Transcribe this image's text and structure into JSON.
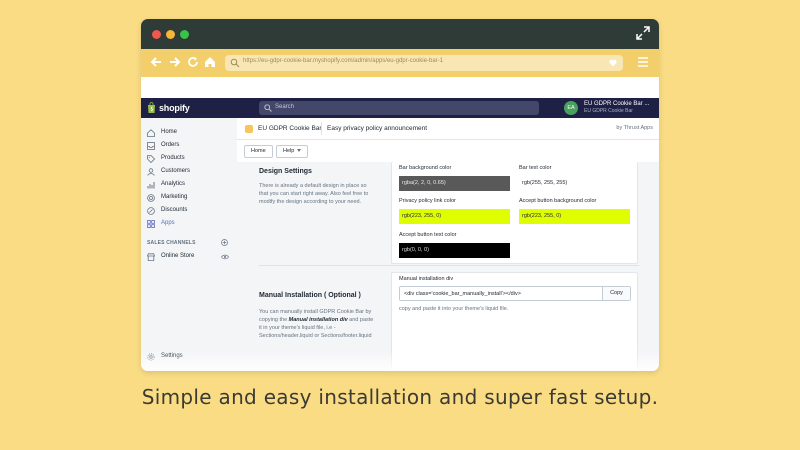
{
  "browser": {
    "url": "https://eu-gdpr-cookie-bar.myshopify.com/admin/apps/eu-gdpr-cookie-bar-1"
  },
  "shopify": {
    "logo": "shopify",
    "search_placeholder": "Search",
    "avatar_initials": "EA",
    "store_name": "EU GDPR Cookie Bar ...",
    "store_sub": "EU GDPR Cookie Bar"
  },
  "sidebar": {
    "items": [
      {
        "label": "Home",
        "icon": "home-icon"
      },
      {
        "label": "Orders",
        "icon": "orders-icon"
      },
      {
        "label": "Products",
        "icon": "tag-icon"
      },
      {
        "label": "Customers",
        "icon": "person-icon"
      },
      {
        "label": "Analytics",
        "icon": "bar-chart-icon"
      },
      {
        "label": "Marketing",
        "icon": "target-icon"
      },
      {
        "label": "Discounts",
        "icon": "discount-icon"
      },
      {
        "label": "Apps",
        "icon": "apps-icon",
        "active": true
      }
    ],
    "channels_label": "SALES CHANNELS",
    "online_store": "Online Store",
    "settings": "Settings"
  },
  "header": {
    "app_name": "EU GDPR Cookie Bar",
    "page_title": "Easy privacy policy announcement",
    "by": "by Thrust Apps"
  },
  "tabs": {
    "home": "Home",
    "help": "Help"
  },
  "design": {
    "title": "Design Settings",
    "description": "There is already a default design in place so that you can start right away. Also feel free to modify the design according to your need.",
    "fields": [
      {
        "label": "Bar background color",
        "value": "rgba(2, 2, 0, 0.65)",
        "bg": "#595959",
        "fg": "#e8e8e8"
      },
      {
        "label": "Bar text color",
        "value": "rgb(255, 255, 255)",
        "bg": "#ffffff",
        "fg": "#212b36"
      },
      {
        "label": "Privacy policy link color",
        "value": "rgb(223, 255, 0)",
        "bg": "#dfff00",
        "fg": "#212b36"
      },
      {
        "label": "Accept button background color",
        "value": "rgb(223, 255, 0)",
        "bg": "#dfff00",
        "fg": "#212b36"
      },
      {
        "label": "Accept button text color",
        "value": "rgb(0, 0, 0)",
        "bg": "#000000",
        "fg": "#dcdcdc"
      }
    ]
  },
  "manual": {
    "title": "Manual Installation ( Optional )",
    "desc_prefix": "You can manually install GDPR Cookie Bar by copying the ",
    "desc_em": "Manual installation div",
    "desc_suffix": " and paste it in your theme's liquid file, i.e - Sections/header.liquid or Sections/footer.liquid",
    "field_label": "Manual installation div",
    "code": "<div class='cookie_bar_manually_install'></div>",
    "copy": "Copy",
    "help": "copy and paste it into your theme's liquid file."
  },
  "caption": "Simple and easy installation and super fast setup.",
  "colors": {
    "background": "#f9dc84",
    "titlebar": "#2e3b37",
    "address_bar": "#f2cf6a",
    "shopify_nav": "#1e2145",
    "accent": "#5c6ac4"
  }
}
